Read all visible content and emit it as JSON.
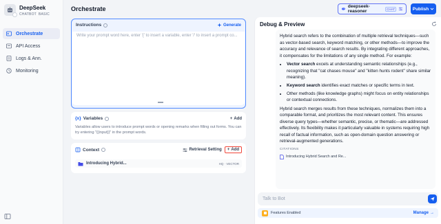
{
  "app": {
    "name": "DeepSeek",
    "tags": [
      "CHATBOT",
      "BASIC"
    ]
  },
  "sidebar": {
    "items": [
      {
        "label": "Orchestrate",
        "icon": "terminal-icon",
        "active": true
      },
      {
        "label": "API Access",
        "icon": "api-icon",
        "active": false
      },
      {
        "label": "Logs & Ann.",
        "icon": "logs-icon",
        "active": false
      },
      {
        "label": "Monitoring",
        "icon": "monitoring-icon",
        "active": false
      }
    ]
  },
  "header": {
    "title": "Orchestrate",
    "model_name": "deepseek-reasoner",
    "model_tag": "CHAT",
    "publish_label": "Publish"
  },
  "instructions": {
    "title": "Instructions",
    "generate_label": "Generate",
    "placeholder": "Write your prompt word here, enter '{' to insert a variable, enter '/' to insert a prompt co..."
  },
  "variables": {
    "title": "Variables",
    "add_label": "Add",
    "description": "Variables allow users to introduce prompt words or opening remarks when filling out forms. You can try entering \"{{input}}\" in the prompt words."
  },
  "context": {
    "title": "Context",
    "retrieval_label": "Retrieval Setting",
    "add_label": "Add",
    "item_name": "Introducing Hybrid...",
    "item_badge": "HQ · VECTOR"
  },
  "debug": {
    "title": "Debug & Preview",
    "answer": {
      "intro": "Hybrid search refers to the combination of multiple retrieval techniques—such as vector-based search, keyword matching, or other methods—to improve the accuracy and relevance of search results. By integrating different approaches, it compensates for the limitations of any single method. For example:",
      "bullets": [
        {
          "bold": "Vector search",
          "text": " excels at understanding semantic relationships (e.g., recognizing that \"cat chases mouse\" and \"kitten hunts rodent\" share similar meaning)."
        },
        {
          "bold": "Keyword search",
          "text": " identifies exact matches or specific terms in text."
        },
        {
          "bold": "",
          "text": "Other methods (like knowledge graphs) might focus on entity relationships or contextual connections."
        }
      ],
      "outro": "Hybrid search merges results from these techniques, normalizes them into a comparable format, and prioritizes the most relevant content. This ensures diverse query types—whether semantic, precise, or thematic—are addressed effectively. Its flexibility makes it particularly valuable in systems requiring high recall of factual information, such as open-domain question answering or retrieval-augmented generations."
    },
    "citations_label": "CITATIONS",
    "citation": "Introducing Hybrid Search and Re...",
    "chat_placeholder": "Talk to Bot",
    "features_label": "Features Enabled",
    "manage_label": "Manage"
  },
  "colors": {
    "accent": "#155eef",
    "highlight_border": "#f04438",
    "instructions_bg": "#eef4ff"
  }
}
